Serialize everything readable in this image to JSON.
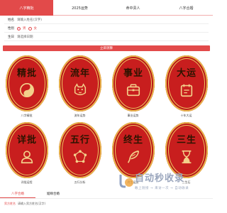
{
  "tabs": [
    {
      "label": "八字精批",
      "active": true
    },
    {
      "label": "2025运势",
      "active": false
    },
    {
      "label": "命中贵人",
      "active": false
    },
    {
      "label": "八字合婚",
      "active": false
    }
  ],
  "form": {
    "name_label": "姓名",
    "name_placeholder": "请输入姓名(汉字)",
    "sex_label": "性别",
    "sex_options": [
      "男",
      "女"
    ],
    "birth_label": "生日",
    "birth_placeholder": "请选择日期"
  },
  "submit_label": "立即测算",
  "services": [
    {
      "title": "精批",
      "caption": "八字精批",
      "icon": "yin-yang-icon"
    },
    {
      "title": "流年",
      "caption": "流年运势",
      "icon": "tiger-icon"
    },
    {
      "title": "事业",
      "caption": "事业运势",
      "icon": "briefcase-icon"
    },
    {
      "title": "大运",
      "caption": "十年大运",
      "icon": "calendar-icon"
    },
    {
      "title": "详批",
      "caption": "详批运程",
      "icon": "person-icon"
    },
    {
      "title": "五行",
      "caption": "五行分析",
      "icon": "wuxing-icon"
    },
    {
      "title": "终生",
      "caption": "终生运势",
      "icon": "feather-icon"
    },
    {
      "title": "三生",
      "caption": "三生石",
      "icon": "hourglass-icon"
    }
  ],
  "footer": {
    "tabs": [
      {
        "label": "八字合婚",
        "active": true
      },
      {
        "label": "姻缘合婚",
        "active": false
      }
    ],
    "row_label": "男方姓名",
    "row_placeholder": "请输入男方姓名(汉字)"
  },
  "watermark": {
    "big": "自动秒收录",
    "small": "敢上链接 → 来访一次 → 自动收录"
  },
  "colors": {
    "accent": "#e24a4a",
    "card": "#c81e1e",
    "gold": "#f0c563"
  }
}
